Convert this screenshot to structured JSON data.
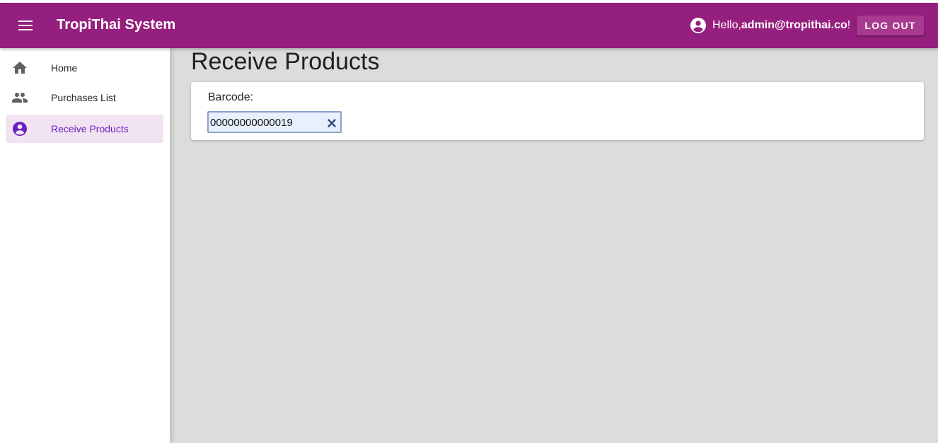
{
  "app": {
    "title": "TropiThai System",
    "brand_color": "#951f7e"
  },
  "header": {
    "greeting_prefix": "Hello, ",
    "user_email": "admin@tropithai.co",
    "greeting_suffix": "!",
    "logout_label": "LOG OUT",
    "icons": {
      "menu": "menu-icon",
      "user": "account-circle-icon"
    }
  },
  "sidebar": {
    "items": [
      {
        "label": "Home",
        "icon": "home-icon",
        "active": false
      },
      {
        "label": "Purchases List",
        "icon": "people-icon",
        "active": false
      },
      {
        "label": "Receive Products",
        "icon": "account-circle-icon",
        "active": true
      }
    ],
    "active_color": "#6a1fc2"
  },
  "main": {
    "page_title": "Receive Products",
    "barcode": {
      "label": "Barcode:",
      "value": "00000000000019",
      "clear_icon": "clear-icon"
    }
  }
}
